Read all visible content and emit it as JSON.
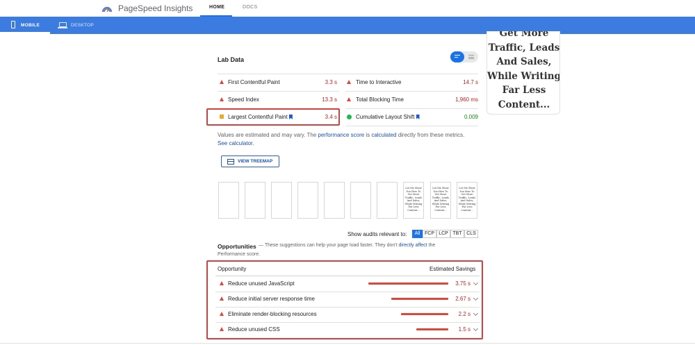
{
  "header": {
    "brand": "PageSpeed Insights",
    "nav": {
      "home": "HOME",
      "docs": "DOCS"
    }
  },
  "device_tabs": {
    "mobile": "MOBILE",
    "desktop": "DESKTOP"
  },
  "lab": {
    "title": "Lab Data",
    "metrics": {
      "fcp": {
        "label": "First Contentful Paint",
        "value": "3.3 s"
      },
      "si": {
        "label": "Speed Index",
        "value": "13.3 s"
      },
      "lcp": {
        "label": "Largest Contentful Paint",
        "value": "3.4 s"
      },
      "tti": {
        "label": "Time to Interactive",
        "value": "14.7 s"
      },
      "tbt": {
        "label": "Total Blocking Time",
        "value": "1,960 ms"
      },
      "cls": {
        "label": "Cumulative Layout Shift",
        "value": "0.009"
      }
    },
    "note": {
      "p1": "Values are estimated and may vary. The ",
      "link1": "performance score",
      "p2": " is ",
      "link2": "calculated",
      "p3": " directly from these metrics. ",
      "link3": "See calculator."
    },
    "treemap_button": "VIEW TREEMAP"
  },
  "filmstrip": {
    "frame_text": "Let Me Show You How To Get More Traffic, Leads And Sales, While Writing Far Less Content..."
  },
  "audits_filter": {
    "label": "Show audits relevant to:",
    "options": [
      "All",
      "FCP",
      "LCP",
      "TBT",
      "CLS"
    ],
    "selected": "All"
  },
  "opportunities": {
    "title": "Opportunities",
    "desc_p1": "— These suggestions can help your page load faster. They don't ",
    "desc_link": "directly affect",
    "desc_p2": " the",
    "desc_line2": "Performance score.",
    "col_opportunity": "Opportunity",
    "col_savings": "Estimated Savings",
    "rows": [
      {
        "label": "Reduce unused JavaScript",
        "value": "3.75 s",
        "fraction": 1.0
      },
      {
        "label": "Reduce initial server response time",
        "value": "2.67 s",
        "fraction": 0.71
      },
      {
        "label": "Eliminate render-blocking resources",
        "value": "2.2 s",
        "fraction": 0.59
      },
      {
        "label": "Reduce unused CSS",
        "value": "1.5 s",
        "fraction": 0.4
      }
    ]
  },
  "promo": {
    "lines": [
      "Get More",
      "Traffic, Leads",
      "And Sales,",
      "While Writing",
      "Far Less",
      "Content..."
    ]
  },
  "colors": {
    "accent": "#3c7ce0",
    "fail": "#e0453a",
    "average": "#f4a62a",
    "pass": "#1fba4c"
  }
}
